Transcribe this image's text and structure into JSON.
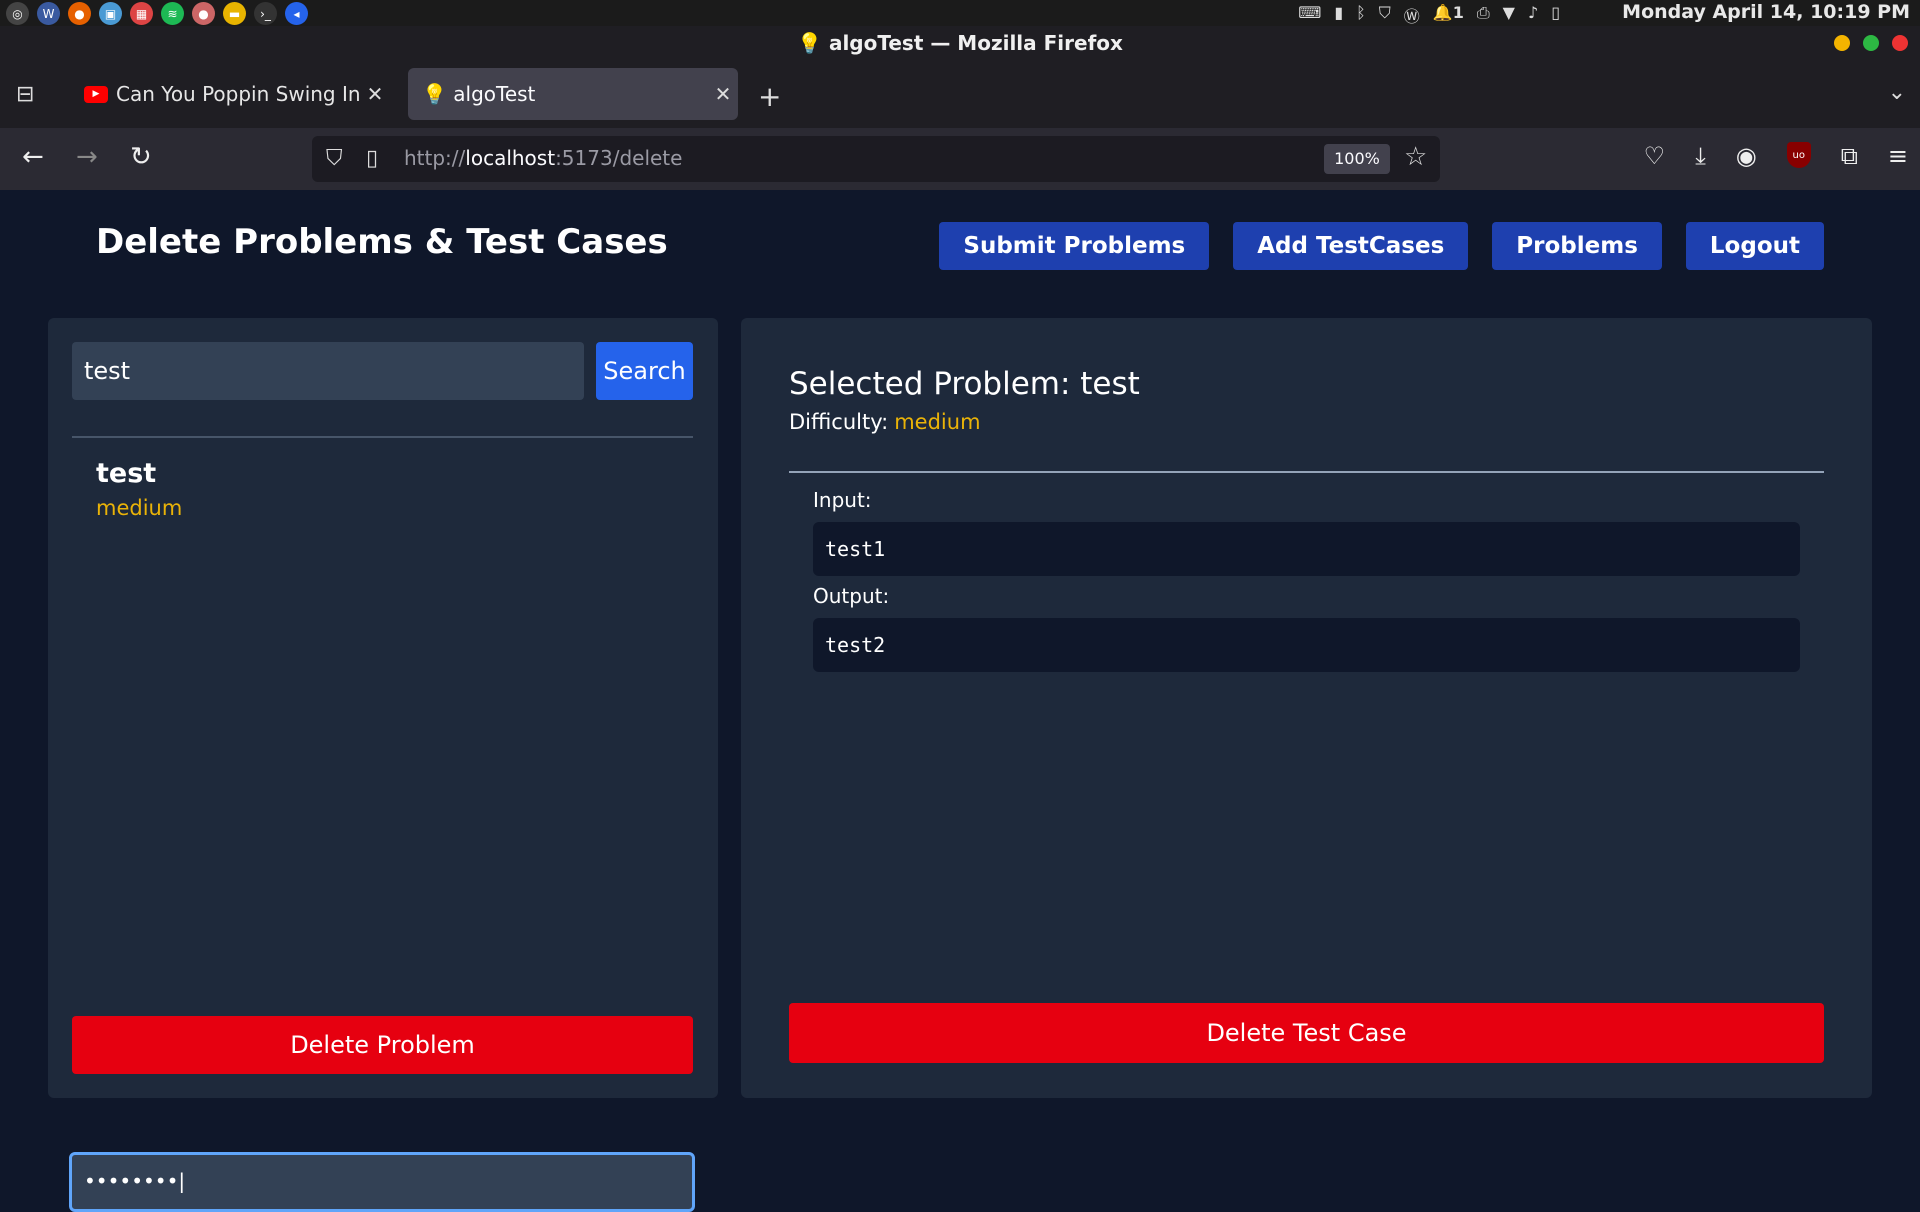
{
  "system": {
    "clock": "Monday April 14, 10:19 PM",
    "tray_notification_count": "1"
  },
  "window": {
    "title": "💡 algoTest — Mozilla Firefox"
  },
  "tabs": [
    {
      "title": "Can You Poppin Swing In Ev",
      "icon": "youtube-icon"
    },
    {
      "title": "💡 algoTest",
      "icon": "lightbulb-icon"
    }
  ],
  "navbar": {
    "url_prefix": "http://",
    "url_host": "localhost",
    "url_rest": ":5173/delete",
    "zoom": "100%"
  },
  "app": {
    "title": "Delete Problems & Test Cases",
    "nav_buttons": [
      "Submit Problems",
      "Add TestCases",
      "Problems",
      "Logout"
    ],
    "search": {
      "value": "test",
      "button": "Search"
    },
    "problems": [
      {
        "name": "test",
        "difficulty": "medium"
      }
    ],
    "delete_problem_label": "Delete Problem",
    "password_value": "••••••••",
    "selected": {
      "title": "Selected Problem: test",
      "difficulty_label": "Difficulty:",
      "difficulty": "medium"
    },
    "testcase": {
      "input_label": "Input:",
      "input": "test1",
      "output_label": "Output:",
      "output": "test2"
    },
    "delete_testcase_label": "Delete Test Case"
  },
  "colors": {
    "background": "#0f172a",
    "panel": "#1e293b",
    "nav_button": "#1e40af",
    "search_button": "#2563eb",
    "danger": "#e60010",
    "difficulty_medium": "#eab308"
  }
}
